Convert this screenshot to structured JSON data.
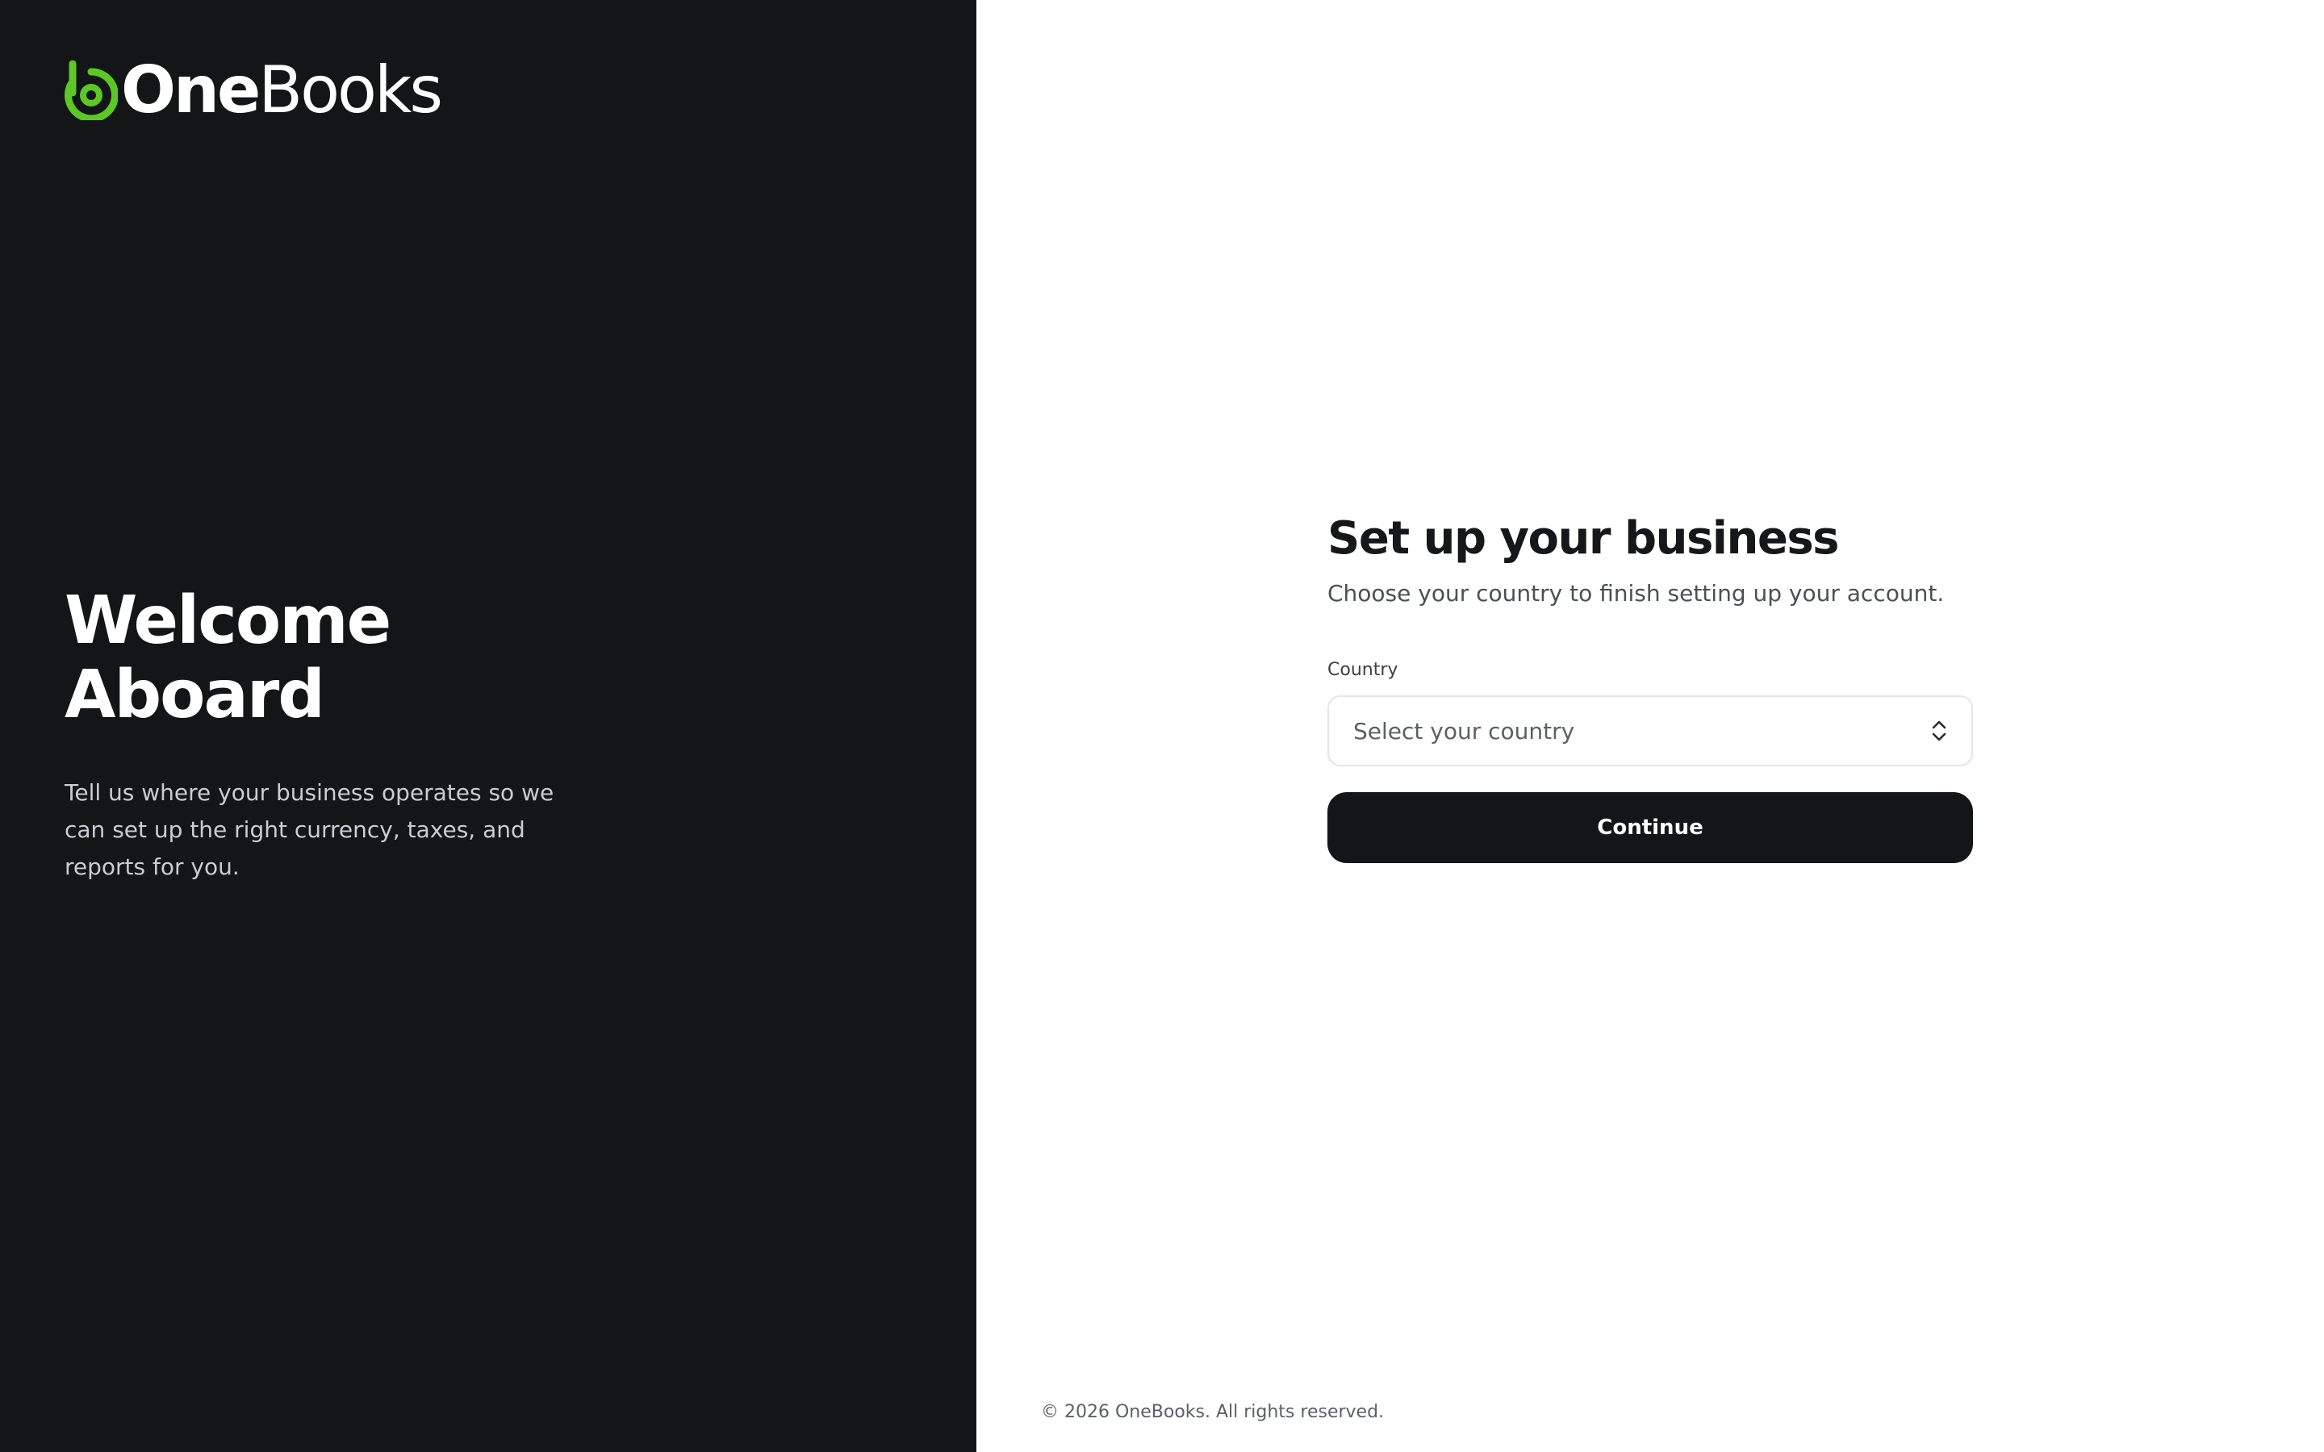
{
  "brand": {
    "name_part1": "One",
    "name_part2": "Books",
    "accent_color": "#5bc826",
    "logo_icon": "onebooks-logo-icon"
  },
  "welcome": {
    "title_line1": "Welcome",
    "title_line2": "Aboard",
    "description": "Tell us where your business operates so we can set up the right currency, taxes, and reports for you."
  },
  "form": {
    "title": "Set up your business",
    "subtitle": "Choose your country to finish setting up your account.",
    "country_label": "Country",
    "country_placeholder": "Select your country",
    "country_icon": "chevron-up-down-icon",
    "continue_label": "Continue"
  },
  "footer": {
    "copyright": "© 2026 OneBooks. All rights reserved."
  },
  "colors": {
    "dark_panel": "#141517",
    "light_panel": "#ffffff",
    "primary_button": "#141517"
  }
}
